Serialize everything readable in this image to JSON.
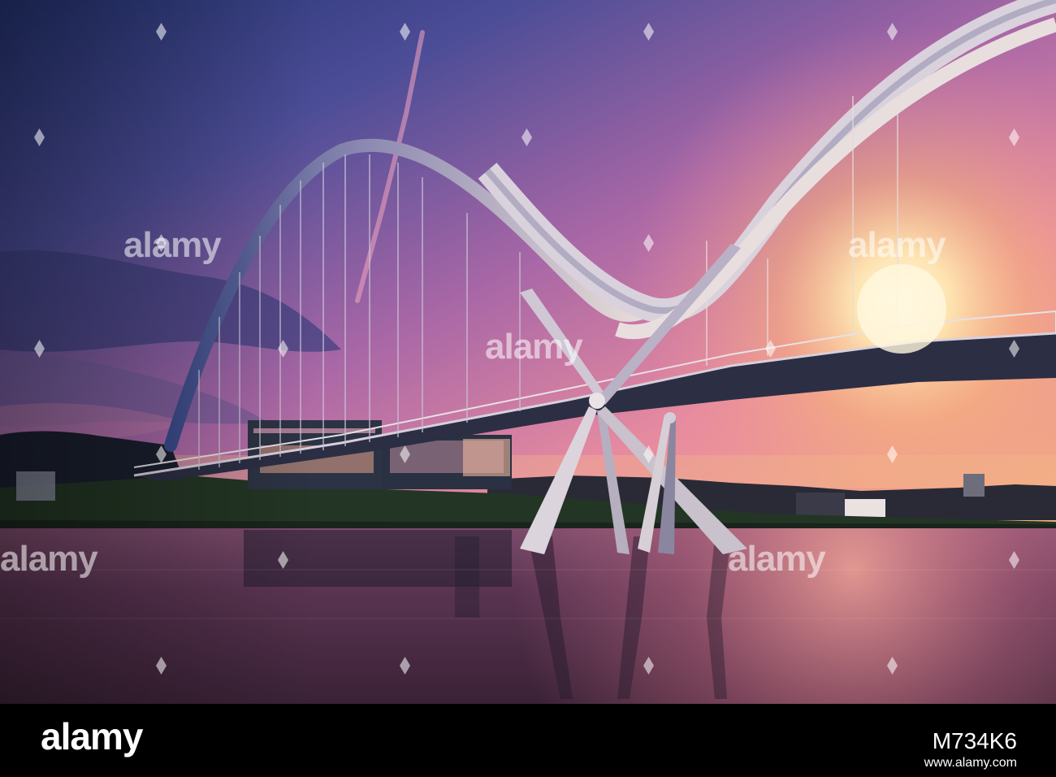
{
  "watermark": {
    "text": "alamy"
  },
  "footer": {
    "logo": "alamy",
    "image_id": "M734K6",
    "url": "www.alamy.com"
  },
  "colors": {
    "sky_top": "#2c3a7a",
    "sky_mid": "#b36aa0",
    "horizon": "#f6b07a",
    "sun": "#fff2c8",
    "water": "#4a2a44",
    "structure": "#d9d4e0",
    "footer_bg": "#000000"
  }
}
